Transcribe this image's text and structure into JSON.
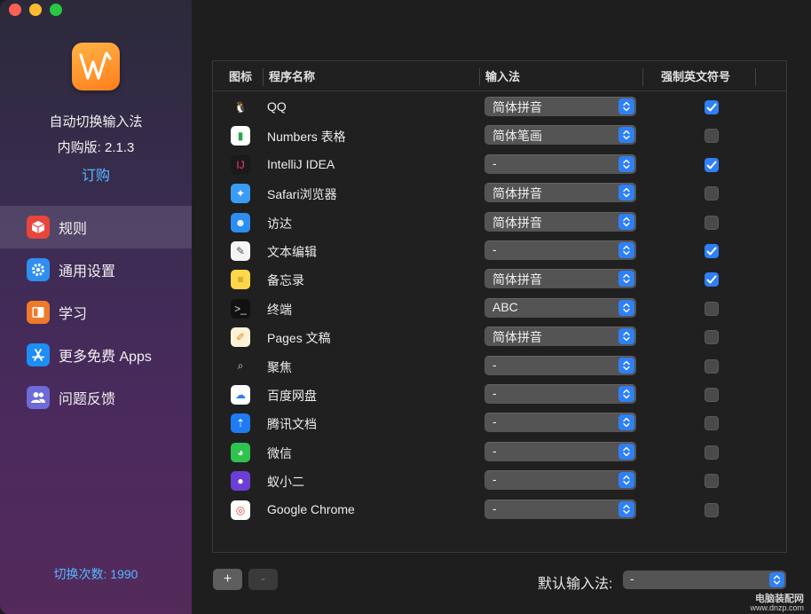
{
  "sidebar": {
    "app_name": "自动切换输入法",
    "version": "内购版: 2.1.3",
    "buy": "订购",
    "items": [
      {
        "label": "规则",
        "icon": "cube-icon"
      },
      {
        "label": "通用设置",
        "icon": "gear-icon"
      },
      {
        "label": "学习",
        "icon": "book-icon"
      },
      {
        "label": "更多免费 Apps",
        "icon": "app-store-icon"
      },
      {
        "label": "问题反馈",
        "icon": "people-icon"
      }
    ],
    "switch_count": "切换次数: 1990"
  },
  "table": {
    "headers": [
      "图标",
      "程序名称",
      "输入法",
      "强制英文符号"
    ],
    "rows": [
      {
        "name": "QQ",
        "icon": "qq-icon",
        "input": "简体拼音",
        "force_english": true
      },
      {
        "name": "Numbers 表格",
        "icon": "numbers-icon",
        "input": "简体笔画",
        "force_english": false
      },
      {
        "name": "IntelliJ IDEA",
        "icon": "intellij-icon",
        "input": "-",
        "force_english": true
      },
      {
        "name": "Safari浏览器",
        "icon": "safari-icon",
        "input": "简体拼音",
        "force_english": false
      },
      {
        "name": "访达",
        "icon": "finder-icon",
        "input": "简体拼音",
        "force_english": false
      },
      {
        "name": "文本编辑",
        "icon": "textedit-icon",
        "input": "-",
        "force_english": true
      },
      {
        "name": "备忘录",
        "icon": "notes-icon",
        "input": "简体拼音",
        "force_english": true
      },
      {
        "name": "终端",
        "icon": "terminal-icon",
        "input": "ABC",
        "force_english": false
      },
      {
        "name": "Pages 文稿",
        "icon": "pages-icon",
        "input": "简体拼音",
        "force_english": false
      },
      {
        "name": "聚焦",
        "icon": "spotlight-icon",
        "input": "-",
        "force_english": false
      },
      {
        "name": "百度网盘",
        "icon": "baidu-netdisk-icon",
        "input": "-",
        "force_english": false
      },
      {
        "name": "腾讯文档",
        "icon": "tencent-docs-icon",
        "input": "-",
        "force_english": false
      },
      {
        "name": "微信",
        "icon": "wechat-icon",
        "input": "-",
        "force_english": false
      },
      {
        "name": "蚁小二",
        "icon": "yixiaoer-icon",
        "input": "-",
        "force_english": false
      },
      {
        "name": "Google Chrome",
        "icon": "chrome-icon",
        "input": "-",
        "force_english": false
      }
    ]
  },
  "footer": {
    "add": "+",
    "remove": "-",
    "default_label": "默认输入法:",
    "default_value": "-"
  },
  "watermark": {
    "name": "电脑装配网",
    "url": "www.dnzp.com"
  },
  "colors": {
    "accent": "#2f7ff5",
    "link": "#55b8ff",
    "close": "#fe5f57",
    "minimize": "#febc2e",
    "zoom": "#28c840"
  }
}
